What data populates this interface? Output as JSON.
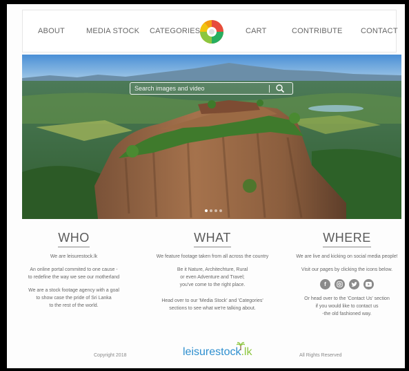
{
  "nav": {
    "items": [
      "ABOUT",
      "MEDIA STOCK",
      "CATEGORIES",
      "CART",
      "CONTRIBUTE",
      "CONTACT"
    ]
  },
  "hero": {
    "search_placeholder": "Search images and video"
  },
  "who": {
    "title": "WHO",
    "lines1": [
      "We are leisurestock.lk"
    ],
    "lines2": [
      "An online portal commited to one cause -",
      "to redefine the way we see our motherland"
    ],
    "lines3": [
      "We are a stock footage agency with a goal",
      "to show case the pride of Sri Lanka",
      "to the rest of the world."
    ]
  },
  "what": {
    "title": "WHAT",
    "lines1": [
      "We feature footage taken from all across the country"
    ],
    "lines2": [
      "Be it Nature, Architechture, Rural",
      "or even Adventure and Travel;",
      "you've come to the right place."
    ],
    "lines3": [
      "Head over to our 'Media Stock' and 'Categories'",
      "sections to see what we're talking about."
    ]
  },
  "where": {
    "title": "WHERE",
    "lines1": [
      "We are live and kicking on social media people!"
    ],
    "lines2": [
      "Visit our pages by clicking the icons below."
    ],
    "social": [
      "facebook-icon",
      "instagram-icon",
      "twitter-icon",
      "youtube-icon"
    ],
    "lines3": [
      "Or head over to the 'Contact Us' section",
      "if you would like to contact us",
      "-the old fashioned way."
    ]
  },
  "footer": {
    "copyright": "Copyright 2018",
    "logo_a": "leisurestock",
    "logo_b": ".lk",
    "rights": "All Rights Reserved"
  },
  "colors": {
    "brand_blue": "#2e8fcf",
    "brand_green": "#8cc63f"
  }
}
